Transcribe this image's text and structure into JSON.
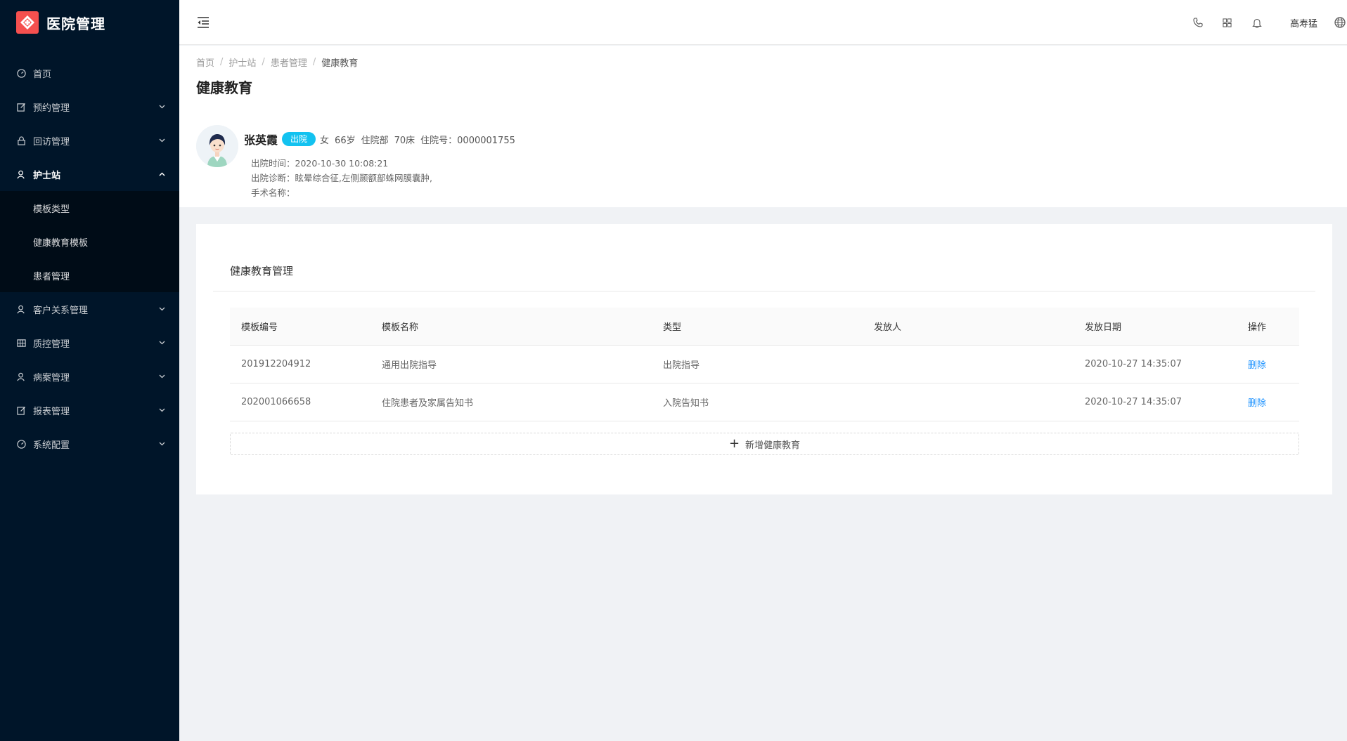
{
  "app": {
    "title": "医院管理"
  },
  "sidebar": {
    "items": [
      {
        "label": "首页",
        "icon": "dashboard-icon",
        "expandable": false
      },
      {
        "label": "预约管理",
        "icon": "edit-icon",
        "expandable": true
      },
      {
        "label": "回访管理",
        "icon": "lock-icon",
        "expandable": true
      },
      {
        "label": "护士站",
        "icon": "user-icon",
        "expandable": true,
        "open": true,
        "children": [
          "模板类型",
          "健康教育模板",
          "患者管理"
        ]
      },
      {
        "label": "客户关系管理",
        "icon": "user-icon",
        "expandable": true
      },
      {
        "label": "质控管理",
        "icon": "table-icon",
        "expandable": true
      },
      {
        "label": "病案管理",
        "icon": "user-icon",
        "expandable": true
      },
      {
        "label": "报表管理",
        "icon": "edit-icon",
        "expandable": true
      },
      {
        "label": "系统配置",
        "icon": "dashboard-icon",
        "expandable": true
      }
    ]
  },
  "header": {
    "user_name": "高寿猛",
    "icons": [
      "phone-icon",
      "appstore-icon",
      "bell-icon",
      "globe-icon"
    ]
  },
  "breadcrumb": [
    "首页",
    "护士站",
    "患者管理",
    "健康教育"
  ],
  "page_title": "健康教育",
  "patient": {
    "name": "张英霞",
    "status": "出院",
    "gender": "女",
    "age": "66岁",
    "department": "住院部",
    "bed": "70床",
    "admission_no": "住院号：0000001755",
    "discharge_time": "出院时间：2020-10-30 10:08:21",
    "diagnosis": "出院诊断：眩晕综合征,左侧颞额部蛛网膜囊肿,",
    "surgery": "手术名称："
  },
  "card": {
    "title": "健康教育管理",
    "columns": [
      "模板编号",
      "模板名称",
      "类型",
      "发放人",
      "发放日期",
      "操作"
    ],
    "rows": [
      {
        "code": "201912204912",
        "name": "通用出院指导",
        "type": "出院指导",
        "issuer": "",
        "date": "2020-10-27 14:35:07",
        "action": "删除"
      },
      {
        "code": "202001066658",
        "name": "住院患者及家属告知书",
        "type": "入院告知书",
        "issuer": "",
        "date": "2020-10-27 14:35:07",
        "action": "删除"
      }
    ],
    "add_label": "新增健康教育"
  },
  "colors": {
    "sidebar_bg": "#001529",
    "accent": "#1890ff",
    "status_tag": "#13c2f0",
    "logo": "#f5504f"
  }
}
